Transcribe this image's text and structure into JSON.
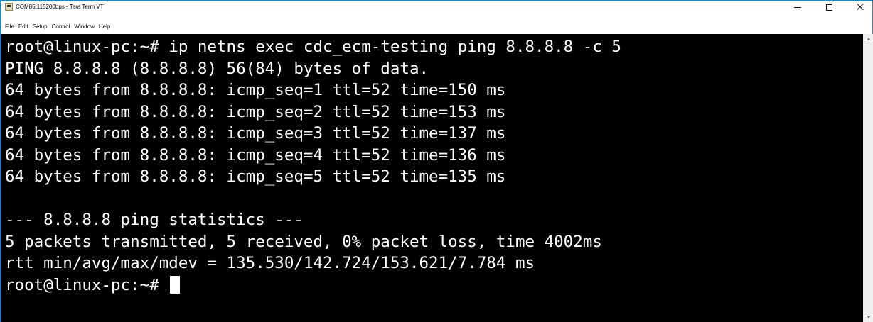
{
  "window": {
    "title": "COM85:115200bps - Tera Term VT",
    "icon": "tera-term-icon",
    "controls": {
      "minimize": "minimize-icon",
      "maximize": "maximize-icon",
      "close": "close-icon"
    }
  },
  "menubar": {
    "items": [
      "File",
      "Edit",
      "Setup",
      "Control",
      "Window",
      "Help"
    ]
  },
  "terminal": {
    "lines": [
      "root@linux-pc:~# ip netns exec cdc_ecm-testing ping 8.8.8.8 -c 5",
      "PING 8.8.8.8 (8.8.8.8) 56(84) bytes of data.",
      "64 bytes from 8.8.8.8: icmp_seq=1 ttl=52 time=150 ms",
      "64 bytes from 8.8.8.8: icmp_seq=2 ttl=52 time=153 ms",
      "64 bytes from 8.8.8.8: icmp_seq=3 ttl=52 time=137 ms",
      "64 bytes from 8.8.8.8: icmp_seq=4 ttl=52 time=136 ms",
      "64 bytes from 8.8.8.8: icmp_seq=5 ttl=52 time=135 ms",
      "",
      "--- 8.8.8.8 ping statistics ---",
      "5 packets transmitted, 5 received, 0% packet loss, time 4002ms",
      "rtt min/avg/max/mdev = 135.530/142.724/153.621/7.784 ms",
      "root@linux-pc:~# "
    ],
    "background": "#000000",
    "foreground": "#ffffff",
    "cursor": "block-cursor"
  },
  "scrollbar": {
    "up": "chevron-up-icon",
    "down": "chevron-down-icon"
  }
}
